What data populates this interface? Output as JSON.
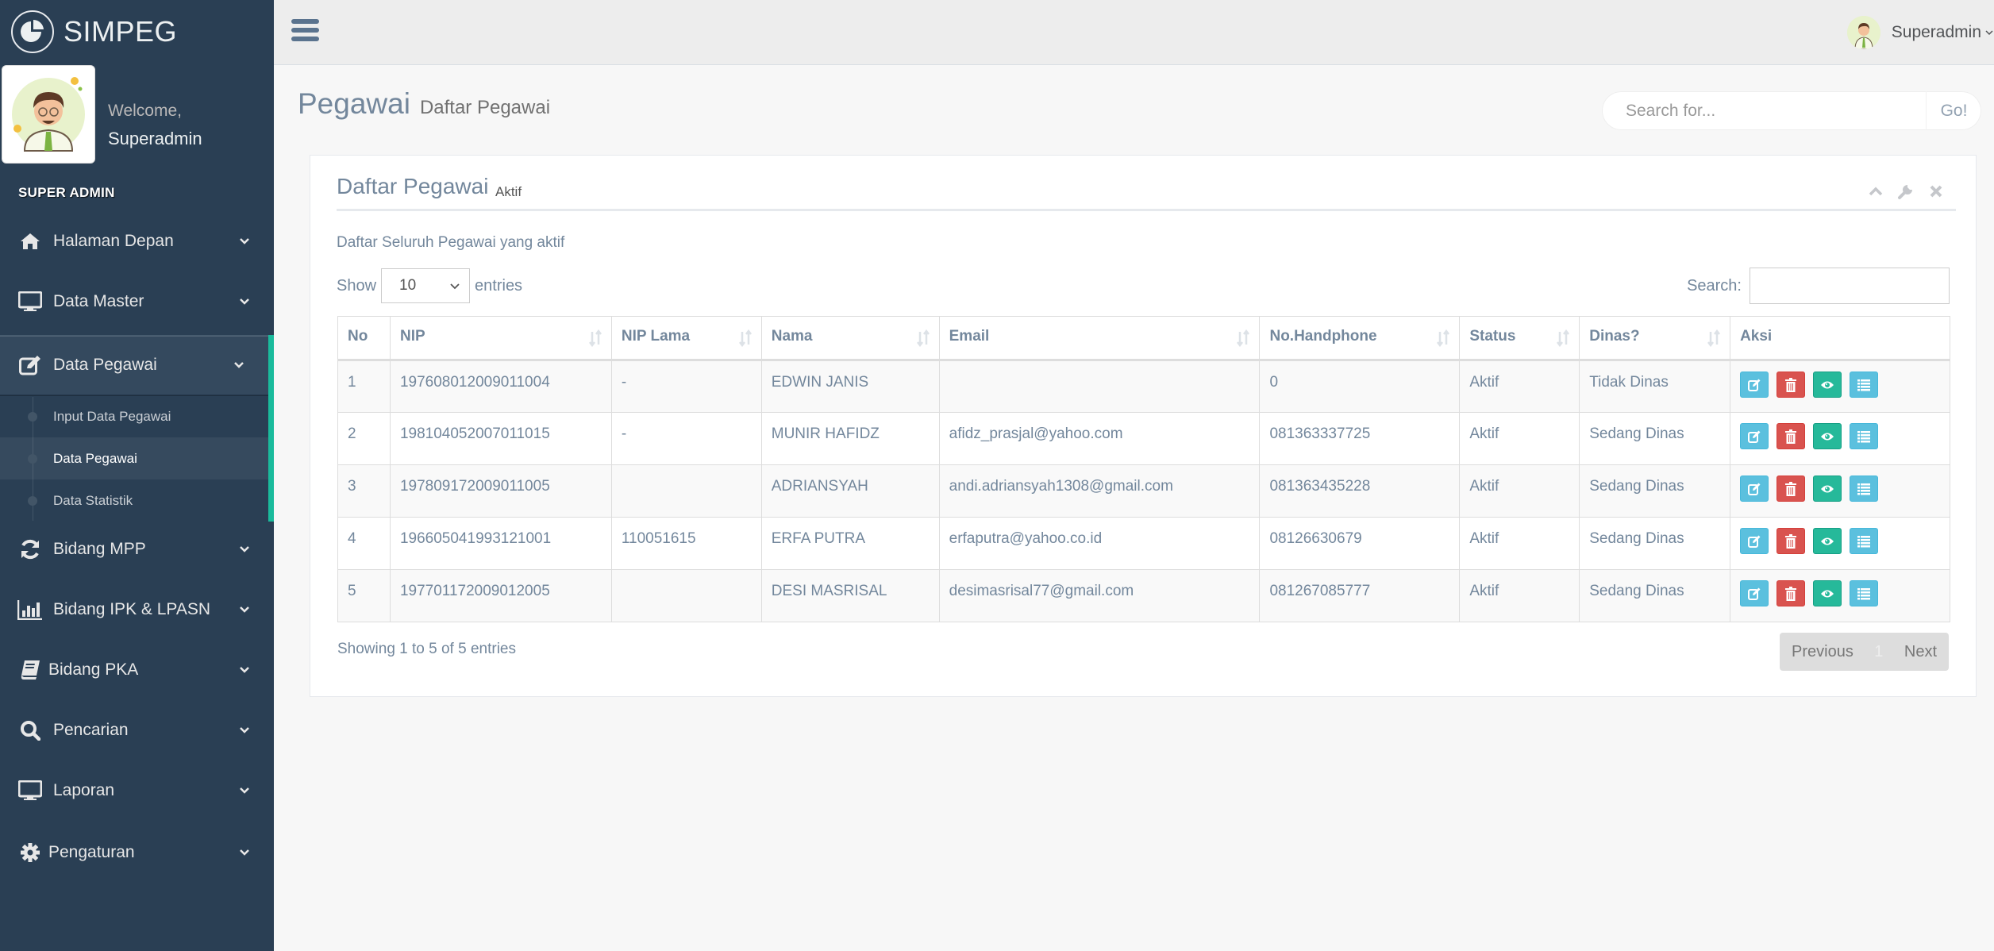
{
  "app": {
    "brand": "SIMPEG",
    "welcome_label": "Welcome,",
    "user_name": "Superadmin",
    "role_section": "SUPER ADMIN"
  },
  "sidebar": {
    "menu": [
      {
        "label": "Halaman Depan",
        "icon": "home-icon"
      },
      {
        "label": "Data Master",
        "icon": "desktop-icon"
      },
      {
        "label": "Data Pegawai",
        "icon": "edit-icon",
        "active": true
      },
      {
        "label": "Bidang MPP",
        "icon": "refresh-icon"
      },
      {
        "label": "Bidang IPK & LPASN",
        "icon": "bar-chart-icon"
      },
      {
        "label": "Bidang PKA",
        "icon": "book-icon"
      },
      {
        "label": "Pencarian",
        "icon": "search-icon"
      },
      {
        "label": "Laporan",
        "icon": "desktop-icon"
      },
      {
        "label": "Pengaturan",
        "icon": "gear-icon"
      }
    ],
    "submenu": [
      {
        "label": "Input Data Pegawai"
      },
      {
        "label": "Data Pegawai",
        "current": true
      },
      {
        "label": "Data Statistik"
      }
    ]
  },
  "topbar": {
    "user_label": "Superadmin"
  },
  "header": {
    "title": "Pegawai",
    "subtitle": "Daftar Pegawai",
    "search_placeholder": "Search for...",
    "search_button": "Go!"
  },
  "panel": {
    "title": "Daftar Pegawai",
    "badge": "Aktif",
    "description": "Daftar Seluruh Pegawai yang aktif",
    "show_label": "Show",
    "entries_label": "entries",
    "page_length": "10",
    "search_label": "Search:",
    "search_value": "",
    "columns": [
      "No",
      "NIP",
      "NIP Lama",
      "Nama",
      "Email",
      "No.Handphone",
      "Status",
      "Dinas?",
      "Aksi"
    ],
    "rows": [
      {
        "no": "1",
        "nip": "197608012009011004",
        "nip_lama": "-",
        "nama": "EDWIN JANIS",
        "email": "",
        "hp": "0",
        "status": "Aktif",
        "dinas": "Tidak Dinas"
      },
      {
        "no": "2",
        "nip": "198104052007011015",
        "nip_lama": "-",
        "nama": "MUNIR HAFIDZ",
        "email": "afidz_prasjal@yahoo.com",
        "hp": "081363337725",
        "status": "Aktif",
        "dinas": "Sedang Dinas"
      },
      {
        "no": "3",
        "nip": "197809172009011005",
        "nip_lama": "",
        "nama": "ADRIANSYAH",
        "email": "andi.adriansyah1308@gmail.com",
        "hp": "081363435228",
        "status": "Aktif",
        "dinas": "Sedang Dinas"
      },
      {
        "no": "4",
        "nip": "196605041993121001",
        "nip_lama": "110051615",
        "nama": "ERFA PUTRA",
        "email": "erfaputra@yahoo.co.id",
        "hp": "08126630679",
        "status": "Aktif",
        "dinas": "Sedang Dinas"
      },
      {
        "no": "5",
        "nip": "197701172009012005",
        "nip_lama": "",
        "nama": "DESI MASRISAL",
        "email": "desimasrisal77@gmail.com",
        "hp": "081267085777",
        "status": "Aktif",
        "dinas": "Sedang Dinas"
      }
    ],
    "actions": [
      {
        "name": "edit",
        "icon": "edit-icon",
        "color": "#5bc0de"
      },
      {
        "name": "delete",
        "icon": "trash-icon",
        "color": "#d9534f"
      },
      {
        "name": "view",
        "icon": "eye-icon",
        "color": "#26b99a"
      },
      {
        "name": "detail",
        "icon": "list-icon",
        "color": "#5bc0de"
      }
    ],
    "info": "Showing 1 to 5 of 5 entries",
    "pagination": {
      "previous": "Previous",
      "current": "1",
      "next": "Next"
    }
  },
  "colors": {
    "sidebar_bg": "#2a3f54",
    "accent_green": "#1abb9c",
    "text_primary": "#73879c"
  }
}
